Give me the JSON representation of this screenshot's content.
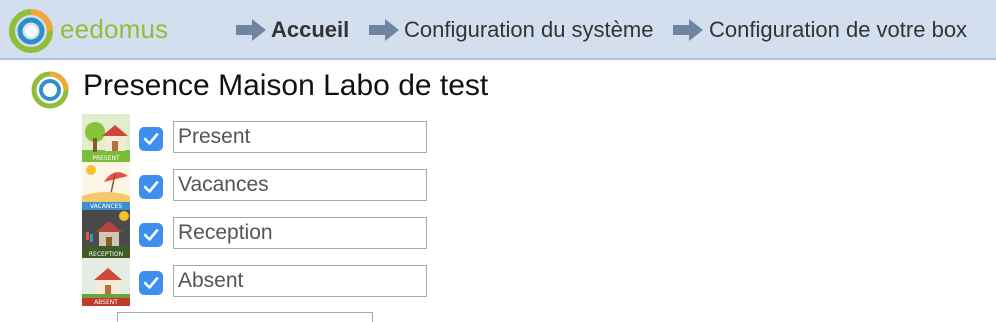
{
  "header": {
    "logo_text": "eedomus",
    "breadcrumbs": [
      {
        "label": "Accueil",
        "active": true
      },
      {
        "label": "Configuration du système",
        "active": false
      },
      {
        "label": "Configuration de votre box",
        "active": false
      }
    ]
  },
  "page": {
    "title": "Presence Maison Labo de test"
  },
  "modes": [
    {
      "value": "Present",
      "thumb_label": "PRESENT",
      "icon": "house-tree-icon",
      "checked": true
    },
    {
      "value": "Vacances",
      "thumb_label": "VACANCES",
      "icon": "beach-umbrella-icon",
      "checked": true
    },
    {
      "value": "Reception",
      "thumb_label": "RECEPTION",
      "icon": "house-party-icon",
      "checked": true
    },
    {
      "value": "Absent",
      "thumb_label": "ABSENT",
      "icon": "house-locked-icon",
      "checked": true
    }
  ],
  "colors": {
    "topbar": "#d3dfee",
    "checkbox": "#3d8ef0",
    "logo_green": "#8fbf3a",
    "logo_blue": "#2f8fc8",
    "logo_orange": "#f3a63b"
  }
}
